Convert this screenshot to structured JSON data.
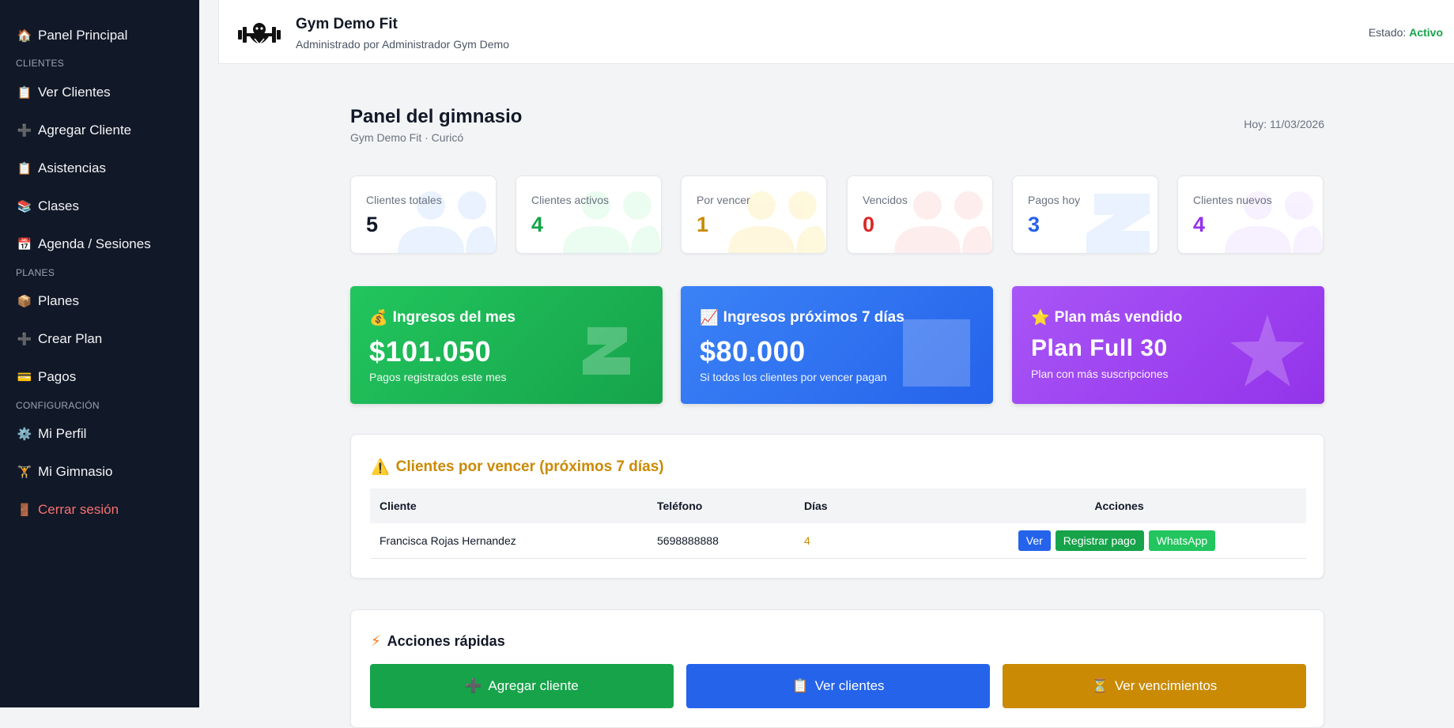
{
  "sidebar": {
    "items": [
      {
        "label": "Panel Principal",
        "icon": "house-icon",
        "glyph": "🏠"
      },
      {
        "label": "Ver Clientes",
        "icon": "clipboard-icon",
        "glyph": "📋"
      },
      {
        "label": "Agregar Cliente",
        "icon": "plus-icon",
        "glyph": "➕"
      },
      {
        "label": "Asistencias",
        "icon": "clipboard-icon",
        "glyph": "📋"
      },
      {
        "label": "Clases",
        "icon": "books-icon",
        "glyph": "📚"
      },
      {
        "label": "Agenda / Sesiones",
        "icon": "calendar-icon",
        "glyph": "📅"
      },
      {
        "label": "Planes",
        "icon": "package-icon",
        "glyph": "📦"
      },
      {
        "label": "Crear Plan",
        "icon": "plus-icon",
        "glyph": "➕"
      },
      {
        "label": "Pagos",
        "icon": "credit-card-icon",
        "glyph": "💳"
      },
      {
        "label": "Mi Perfil",
        "icon": "gear-icon",
        "glyph": "⚙️"
      },
      {
        "label": "Mi Gimnasio",
        "icon": "weightlifter-icon",
        "glyph": "🏋"
      },
      {
        "label": "Cerrar sesión",
        "icon": "door-icon",
        "glyph": "🚪"
      }
    ],
    "sections": [
      "CLIENTES",
      "PLANES",
      "CONFIGURACIÓN"
    ]
  },
  "header": {
    "gym_name": "Gym Demo Fit",
    "admin": "Administrado por Administrador Gym Demo",
    "estado_label": "Estado:",
    "estado_value": "Activo"
  },
  "page": {
    "title": "Panel del gimnasio",
    "subtitle": "Gym Demo Fit · Curicó",
    "today": "Hoy: 11/03/2026"
  },
  "stats": [
    {
      "label": "Clientes totales",
      "value": "5",
      "color": "#111827",
      "tint": "#dbeafe"
    },
    {
      "label": "Clientes activos",
      "value": "4",
      "color": "#16a34a",
      "tint": "#dcfce7"
    },
    {
      "label": "Por vencer",
      "value": "1",
      "color": "#ca8a04",
      "tint": "#fef3c7"
    },
    {
      "label": "Vencidos",
      "value": "0",
      "color": "#dc2626",
      "tint": "#fee2e2"
    },
    {
      "label": "Pagos hoy",
      "value": "3",
      "color": "#2563eb",
      "tint": "#dbeafe"
    },
    {
      "label": "Clientes nuevos",
      "value": "4",
      "color": "#9333ea",
      "tint": "#f3e8ff"
    }
  ],
  "highlights": [
    {
      "title": "Ingresos del mes",
      "glyph": "💰",
      "value": "$101.050",
      "sub": "Pagos registrados este mes",
      "from": "#22c55e",
      "to": "#16a34a"
    },
    {
      "title": "Ingresos próximos 7 días",
      "glyph": "📈",
      "value": "$80.000",
      "sub": "Si todos los clientes por vencer pagan",
      "from": "#3b82f6",
      "to": "#2563eb"
    },
    {
      "title": "Plan más vendido",
      "glyph": "⭐",
      "value": "Plan Full 30",
      "sub": "Plan con más suscripciones",
      "from": "#a855f7",
      "to": "#9333ea"
    }
  ],
  "expiring": {
    "title": "Clientes por vencer (próximos 7 días)",
    "glyph": "⚠️",
    "columns": [
      "Cliente",
      "Teléfono",
      "Días",
      "Acciones"
    ],
    "rows": [
      {
        "cliente": "Francisca Rojas Hernandez",
        "telefono": "5698888888",
        "dias": "4"
      }
    ],
    "actions": {
      "ver": "Ver",
      "pago": "Registrar pago",
      "whatsapp": "WhatsApp"
    }
  },
  "quick": {
    "title": "Acciones rápidas",
    "glyph": "⚡",
    "buttons": [
      {
        "label": "Agregar cliente",
        "glyph": "➕",
        "color": "#16a34a"
      },
      {
        "label": "Ver clientes",
        "glyph": "📋",
        "color": "#2563eb"
      },
      {
        "label": "Ver vencimientos",
        "glyph": "⏳",
        "color": "#ca8a04"
      }
    ]
  }
}
